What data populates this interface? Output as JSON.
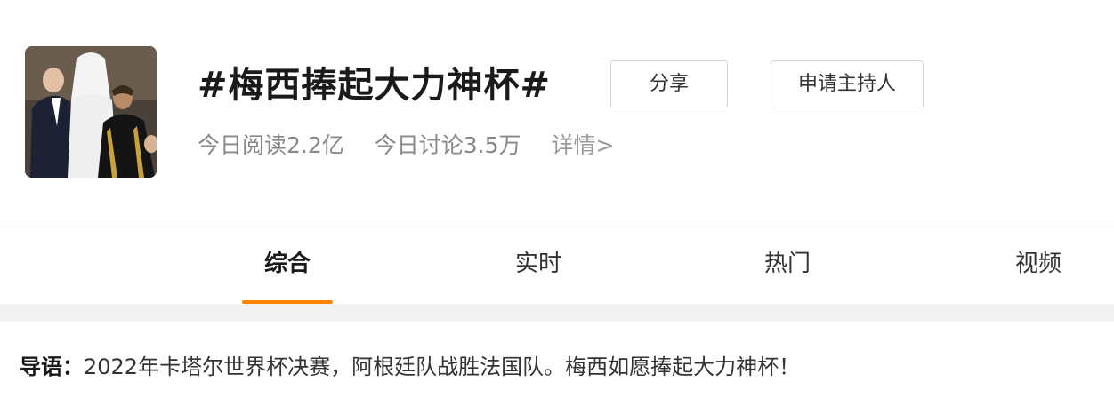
{
  "topic": {
    "title": "#梅西捧起大力神杯#",
    "share_label": "分享",
    "apply_host_label": "申请主持人",
    "read_today": "今日阅读2.2亿",
    "discuss_today": "今日讨论3.5万",
    "detail_link": "详情>"
  },
  "tabs": [
    {
      "label": "综合",
      "active": true
    },
    {
      "label": "实时",
      "active": false
    },
    {
      "label": "热门",
      "active": false
    },
    {
      "label": "视频",
      "active": false
    }
  ],
  "intro": {
    "label": "导语：",
    "text": "2022年卡塔尔世界杯决赛，阿根廷队战胜法国队。梅西如愿捧起大力神杯！"
  },
  "colors": {
    "accent": "#ff8200",
    "background": "#f2f2f2",
    "card": "#ffffff"
  }
}
